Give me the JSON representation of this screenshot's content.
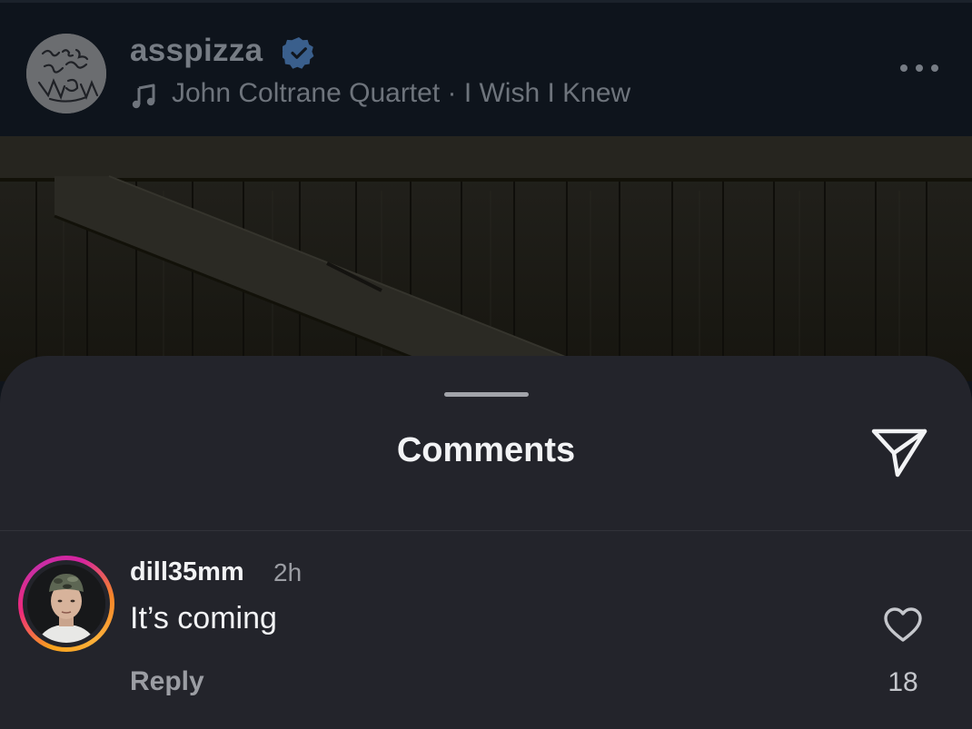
{
  "post": {
    "username": "asspizza",
    "audio": "John Coltrane Quartet · I Wish I Knew",
    "verified_badge_color": "#3897f0",
    "icons": {
      "verified": "verified-badge-icon",
      "music": "music-note-icon",
      "more": "more-options-icon"
    }
  },
  "comments_sheet": {
    "title": "Comments",
    "share_icon": "send-icon",
    "comments": [
      {
        "username": "dill35mm",
        "time": "2h",
        "text": "It’s coming",
        "reply_label": "Reply",
        "likes": "18",
        "like_icon": "heart-outline-icon"
      }
    ]
  },
  "colors": {
    "sheet_background": "#23242b",
    "story_ring_start": "#f9a21c",
    "story_ring_end": "#c82ea6",
    "primary_text": "#f2f3f5",
    "secondary_text": "#9b9da3"
  }
}
